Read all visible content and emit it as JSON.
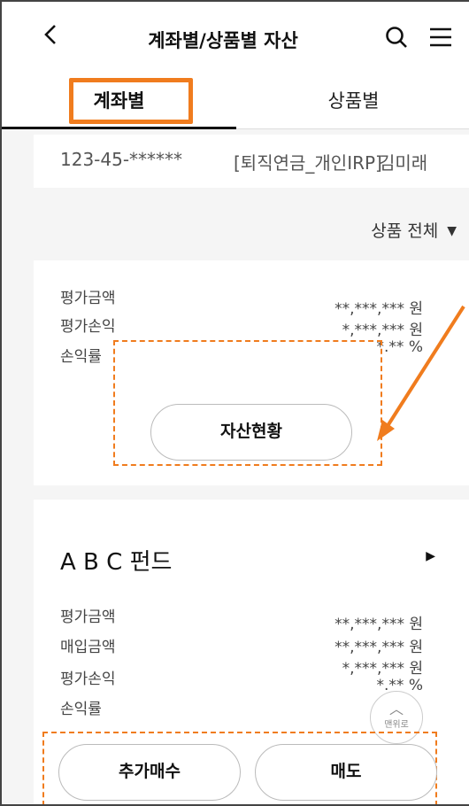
{
  "header": {
    "back_icon": "chevron-left-icon",
    "title": "계좌별/상품별 자산",
    "search_icon": "search-icon",
    "menu_icon": "hamburger-menu-icon"
  },
  "tabs": [
    {
      "label": "계좌별",
      "active": true
    },
    {
      "label": "상품별",
      "active": false
    }
  ],
  "account": {
    "number": "123-45-******",
    "type": "[퇴직연금_개인IRP]",
    "holder": "김미래"
  },
  "filter": {
    "label": "상품 전체"
  },
  "summary": {
    "rows": [
      {
        "label": "평가금액",
        "value": "**,***,*** 원"
      },
      {
        "label": "평가손익",
        "value": "*,***,*** 원"
      },
      {
        "label": "손익률",
        "value": "*.** %"
      }
    ],
    "button_label": "자산현황"
  },
  "fund": {
    "name": "A B C 펀드",
    "rows": [
      {
        "label": "평가금액",
        "value": "**,***,*** 원"
      },
      {
        "label": "매입금액",
        "value": "**,***,*** 원"
      },
      {
        "label": "평가손익",
        "value": "*,***,*** 원"
      },
      {
        "label": "손익률",
        "value": "*.** %"
      }
    ],
    "buy_label": "추가매수",
    "sell_label": "매도"
  },
  "top_button": {
    "label": "맨위로"
  },
  "colors": {
    "accent_orange": "#f07c1e",
    "background": "#f5f5f5",
    "card": "#ffffff"
  }
}
